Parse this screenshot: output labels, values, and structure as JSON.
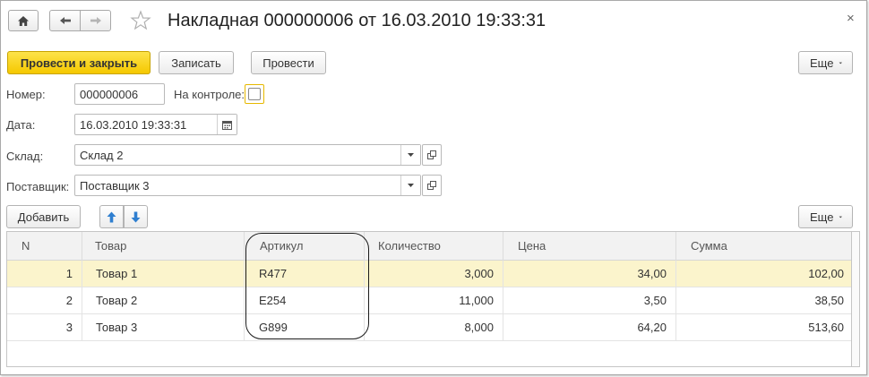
{
  "window": {
    "title": "Накладная 000000006 от 16.03.2010 19:33:31",
    "icons": [
      "home-icon",
      "back-arrow-icon",
      "forward-arrow-icon",
      "favorite-star-icon",
      "close-icon"
    ],
    "close_glyph": "×"
  },
  "toolbar": {
    "post_and_close_label": "Провести и закрыть",
    "write_label": "Записать",
    "post_label": "Провести",
    "more_label": "Еще"
  },
  "form": {
    "number_label": "Номер:",
    "number_value": "000000006",
    "on_control_label": "На контроле:",
    "on_control_checked": false,
    "date_label": "Дата:",
    "date_value": "16.03.2010 19:33:31",
    "warehouse_label": "Склад:",
    "warehouse_value": "Склад 2",
    "supplier_label": "Поставщик:",
    "supplier_value": "Поставщик 3"
  },
  "table_toolbar": {
    "add_label": "Добавить",
    "more_label": "Еще"
  },
  "table": {
    "columns": [
      "N",
      "Товар",
      "Артикул",
      "Количество",
      "Цена",
      "Сумма"
    ],
    "rows": [
      {
        "n": "1",
        "product": "Товар 1",
        "sku": "R477",
        "qty": "3,000",
        "price": "34,00",
        "sum": "102,00"
      },
      {
        "n": "2",
        "product": "Товар 2",
        "sku": "E254",
        "qty": "11,000",
        "price": "3,50",
        "sum": "38,50"
      },
      {
        "n": "3",
        "product": "Товар 3",
        "sku": "G899",
        "qty": "8,000",
        "price": "64,20",
        "sum": "513,60"
      }
    ],
    "selected_row": 0
  },
  "colors": {
    "accent": "#f5c800",
    "selected_row": "#fbf4cc",
    "arrow_blue": "#2f7fd0"
  }
}
